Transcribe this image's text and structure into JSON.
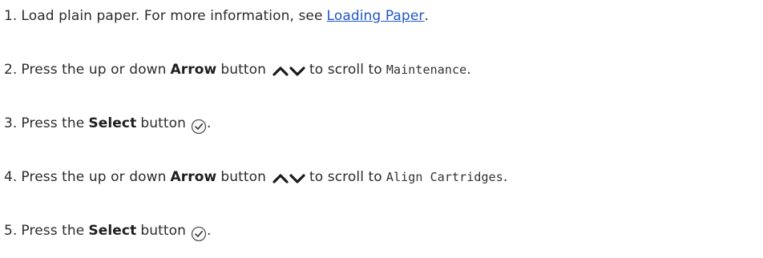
{
  "steps": [
    {
      "number": "1.",
      "text_before": "Load plain paper. For more information, see",
      "link": "Loading Paper",
      "text_after": "."
    },
    {
      "number": "2.",
      "text_before": "Press the up or down",
      "bold": "Arrow",
      "text_mid": "button",
      "text_after": "to scroll to",
      "code": "Maintenance",
      "end": "."
    },
    {
      "number": "3.",
      "text_before": "Press the",
      "bold": "Select",
      "text_mid": "button",
      "end": "."
    },
    {
      "number": "4.",
      "text_before": "Press the up or down",
      "bold": "Arrow",
      "text_mid": "button",
      "text_after": "to scroll to",
      "code": "Align Cartridges",
      "end": "."
    },
    {
      "number": "5.",
      "text_before": "Press the",
      "bold": "Select",
      "text_mid": "button",
      "end": "."
    }
  ],
  "icons": {
    "arrow_pair": "up-down-arrow-icon",
    "select": "select-checkmark-icon"
  },
  "colors": {
    "link": "#1f56c7",
    "text": "#2b2b2b"
  }
}
